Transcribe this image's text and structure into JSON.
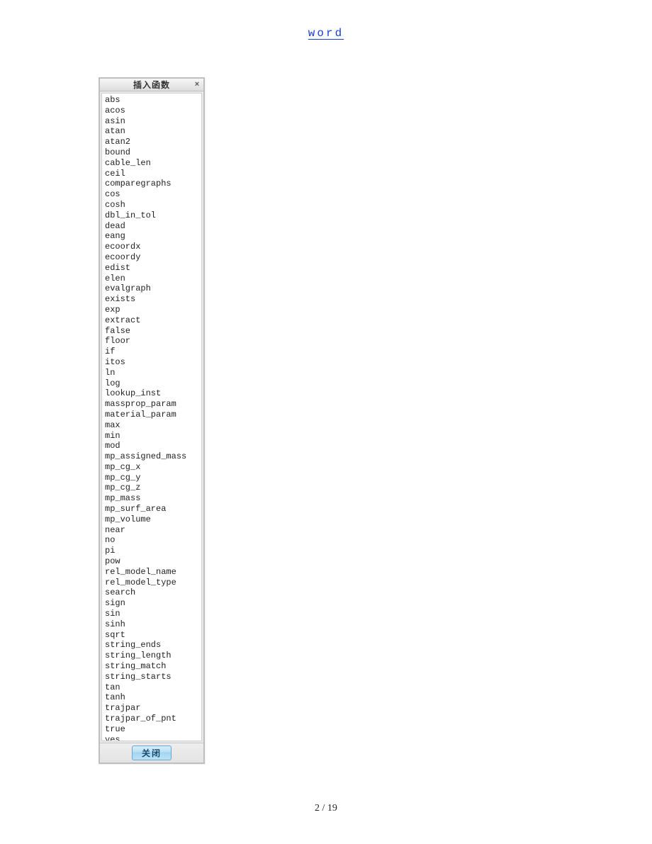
{
  "header": {
    "link_text": "word"
  },
  "dialog": {
    "title": "插入函数",
    "close_glyph": "×",
    "close_button_label": "关闭",
    "items": [
      "abs",
      "acos",
      "asin",
      "atan",
      "atan2",
      "bound",
      "cable_len",
      "ceil",
      "comparegraphs",
      "cos",
      "cosh",
      "dbl_in_tol",
      "dead",
      "eang",
      "ecoordx",
      "ecoordy",
      "edist",
      "elen",
      "evalgraph",
      "exists",
      "exp",
      "extract",
      "false",
      "floor",
      "if",
      "itos",
      "ln",
      "log",
      "lookup_inst",
      "massprop_param",
      "material_param",
      "max",
      "min",
      "mod",
      "mp_assigned_mass",
      "mp_cg_x",
      "mp_cg_y",
      "mp_cg_z",
      "mp_mass",
      "mp_surf_area",
      "mp_volume",
      "near",
      "no",
      "pi",
      "pow",
      "rel_model_name",
      "rel_model_type",
      "search",
      "sign",
      "sin",
      "sinh",
      "sqrt",
      "string_ends",
      "string_length",
      "string_match",
      "string_starts",
      "tan",
      "tanh",
      "trajpar",
      "trajpar_of_pnt",
      "true",
      "yes"
    ]
  },
  "footer": {
    "page_indicator": "2 / 19"
  }
}
